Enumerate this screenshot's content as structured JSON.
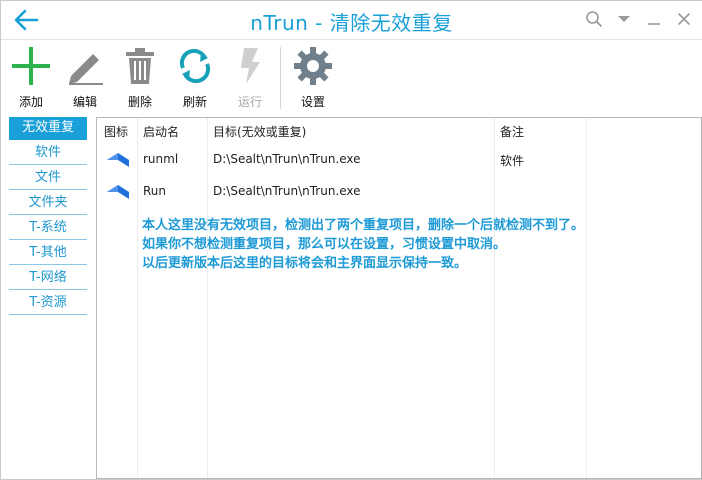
{
  "window": {
    "title": "nTrun - 清除无效重复"
  },
  "titlebar_icons": [
    "search-icon",
    "dropdown-icon",
    "minimize-icon",
    "close-icon"
  ],
  "toolbar": {
    "add": "添加",
    "edit": "编辑",
    "delete": "删除",
    "refresh": "刷新",
    "run": "运行",
    "settings": "设置"
  },
  "sidebar": {
    "items": [
      {
        "label": "无效重复",
        "active": true
      },
      {
        "label": "软件"
      },
      {
        "label": "文件"
      },
      {
        "label": "文件夹"
      },
      {
        "label": "T-系统"
      },
      {
        "label": "T-其他"
      },
      {
        "label": "T-网络"
      },
      {
        "label": "T-资源"
      }
    ]
  },
  "table": {
    "headers": {
      "icon": "图标",
      "name": "启动名",
      "target": "目标(无效或重复)",
      "note": "备注"
    },
    "rows": [
      {
        "name": "runml",
        "target": "D:\\Sealt\\nTrun\\nTrun.exe",
        "note": "软件"
      },
      {
        "name": "Run",
        "target": "D:\\Sealt\\nTrun\\nTrun.exe",
        "note": ""
      }
    ]
  },
  "note": {
    "line1": "本人这里没有无效项目，检测出了两个重复项目，删除一个后就检测不到了。",
    "line2": "如果你不想检测重复项目，那么可以在设置，习惯设置中取消。",
    "line3": "以后更新版本后这里的目标将会和主界面显示保持一致。"
  },
  "colors": {
    "accent": "#1aa0d8",
    "add_green": "#2bb24c",
    "refresh_teal": "#17a2b8",
    "gray_icon": "#8a8a8a"
  }
}
